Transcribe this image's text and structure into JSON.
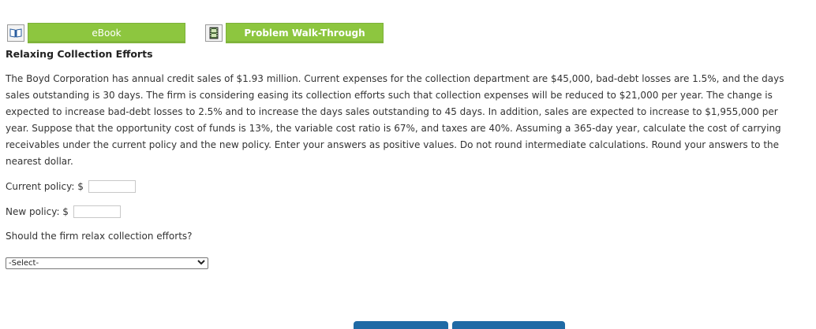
{
  "tabs": {
    "ebook_label": "eBook",
    "walkthrough_label": "Problem Walk-Through",
    "ebook_icon": "book-icon",
    "walkthrough_icon": "film-icon",
    "accent": "#8dc63f"
  },
  "problem": {
    "title": "Relaxing Collection Efforts",
    "text": "The Boyd Corporation has annual credit sales of $1.93 million. Current expenses for the collection department are $45,000, bad-debt losses are 1.5%, and the days sales outstanding is 30 days. The firm is considering easing its collection efforts such that collection expenses will be reduced to $21,000 per year. The change is expected to increase bad-debt losses to 2.5% and to increase the days sales outstanding to 45 days. In addition, sales are expected to increase to $1,955,000 per year. Suppose that the opportunity cost of funds is 13%, the variable cost ratio is 67%, and taxes are 40%. Assuming a 365-day year, calculate the cost of carrying receivables under the current policy and the new policy. Enter your answers as positive values. Do not round intermediate calculations. Round your answers to the nearest dollar."
  },
  "inputs": {
    "current_label": "Current policy: $",
    "current_value": "",
    "new_label": "New policy: $",
    "new_value": ""
  },
  "question": {
    "text": "Should the firm relax collection efforts?",
    "select_value": "-Select-"
  },
  "colors": {
    "bottom_button": "#1f6aa5"
  }
}
